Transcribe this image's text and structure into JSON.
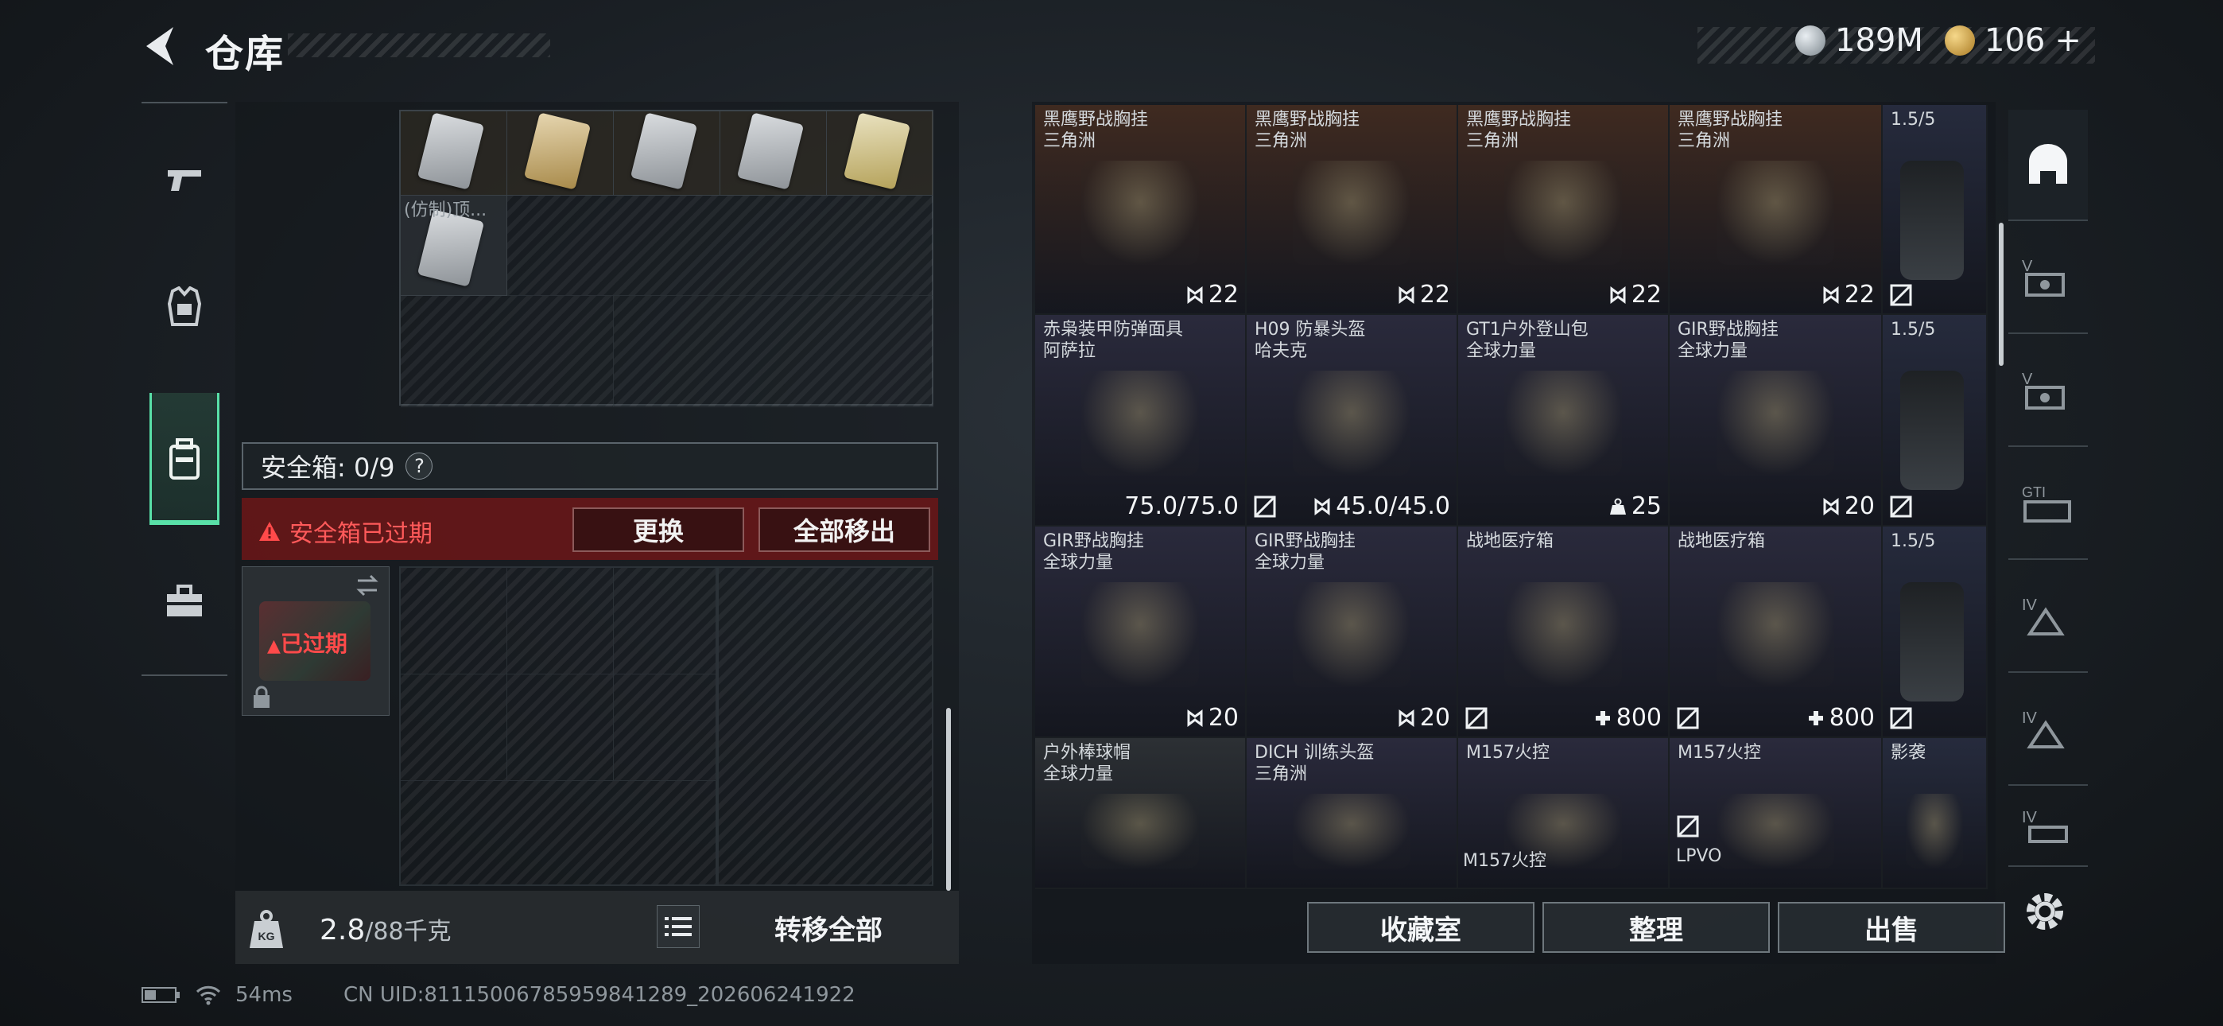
{
  "header": {
    "title": "仓库",
    "currency_1": "189M",
    "currency_2": "106",
    "currency_2_plus": "+"
  },
  "category_sidebar": {
    "items": [
      "pistol-icon",
      "armor-vest-icon",
      "backpack-icon",
      "toolbox-icon"
    ],
    "active_index": 2
  },
  "stash": {
    "item_overflow_label": "(仿制)顶...",
    "safe_box_label": "安全箱: 0/9",
    "safe_box_help": "?",
    "expired_message": "安全箱已过期",
    "replace_button": "更换",
    "remove_all_button": "全部移出",
    "case_status": "已过期",
    "weight_current": "2.8",
    "weight_max": "/88千克",
    "transfer_all_button": "转移全部"
  },
  "items": [
    {
      "name": "黑鹰野战胸挂",
      "sub": "三角洲",
      "value": "22",
      "icon": "capacity-icon",
      "color": "#3f2a20"
    },
    {
      "name": "黑鹰野战胸挂",
      "sub": "三角洲",
      "value": "22",
      "icon": "capacity-icon",
      "color": "#3f2a20"
    },
    {
      "name": "黑鹰野战胸挂",
      "sub": "三角洲",
      "value": "22",
      "icon": "capacity-icon",
      "color": "#3f2a20"
    },
    {
      "name": "黑鹰野战胸挂",
      "sub": "三角洲",
      "value": "22",
      "icon": "capacity-icon",
      "color": "#3f2a20"
    },
    {
      "name": "1.5/5",
      "sub": "",
      "value": "",
      "icon": "scope-icon",
      "color": "#262b3d"
    },
    {
      "name": "赤枭装甲防弹面具",
      "sub": "阿萨拉",
      "value": "75.0/75.0",
      "icon": "",
      "color": "#2a2a3c"
    },
    {
      "name": "H09 防暴头盔",
      "sub": "哈夫克",
      "value": "45.0/45.0",
      "icon": "capacity-icon",
      "color": "#2a2a3c"
    },
    {
      "name": "GT1户外登山包",
      "sub": "全球力量",
      "value": "25",
      "icon": "weight-icon",
      "color": "#2a2a3c"
    },
    {
      "name": "GIR野战胸挂",
      "sub": "全球力量",
      "value": "20",
      "icon": "capacity-icon",
      "color": "#2a2a3c"
    },
    {
      "name": "1.5/5",
      "sub": "",
      "value": "",
      "icon": "scope-icon",
      "color": "#262b3d"
    },
    {
      "name": "GIR野战胸挂",
      "sub": "全球力量",
      "value": "20",
      "icon": "capacity-icon",
      "color": "#2a2a3c"
    },
    {
      "name": "GIR野战胸挂",
      "sub": "全球力量",
      "value": "20",
      "icon": "capacity-icon",
      "color": "#2a2a3c"
    },
    {
      "name": "战地医疗箱",
      "sub": "",
      "value": "800",
      "icon": "plus-icon",
      "color": "#2a2a3c"
    },
    {
      "name": "战地医疗箱",
      "sub": "",
      "value": "800",
      "icon": "plus-icon",
      "color": "#2a2a3c"
    },
    {
      "name": "1.5/5",
      "sub": "",
      "value": "",
      "icon": "scope-icon",
      "color": "#262b3d"
    },
    {
      "name": "户外棒球帽",
      "sub": "全球力量",
      "value": "",
      "icon": "",
      "color": "#2c3034"
    },
    {
      "name": "DICH 训练头盔",
      "sub": "三角洲",
      "value": "",
      "icon": "",
      "color": "#2a2a3c"
    },
    {
      "name": "M157火控",
      "sub": "",
      "value": "",
      "icon": "",
      "color": "#2a2a3c"
    },
    {
      "name": "M157火控",
      "sub": "",
      "value": "",
      "icon": "",
      "color": "#2a2a3c"
    },
    {
      "name": "影袭",
      "sub": "",
      "value": "",
      "icon": "",
      "color": "#262b3d"
    }
  ],
  "extra_labels": [
    "M157火控",
    "LPVO"
  ],
  "actions": {
    "collection_room": "收藏室",
    "organize": "整理",
    "sell": "出售"
  },
  "filter_sidebar": [
    "helmet-icon",
    "v-level-icon",
    "v-level-icon",
    "gt-level-icon",
    "iv-level-icon",
    "iv-level-icon",
    "iv-level-icon"
  ],
  "status_bar": {
    "ping": "54ms",
    "uid": "CN UID:81115006785959841289_202606241922"
  }
}
